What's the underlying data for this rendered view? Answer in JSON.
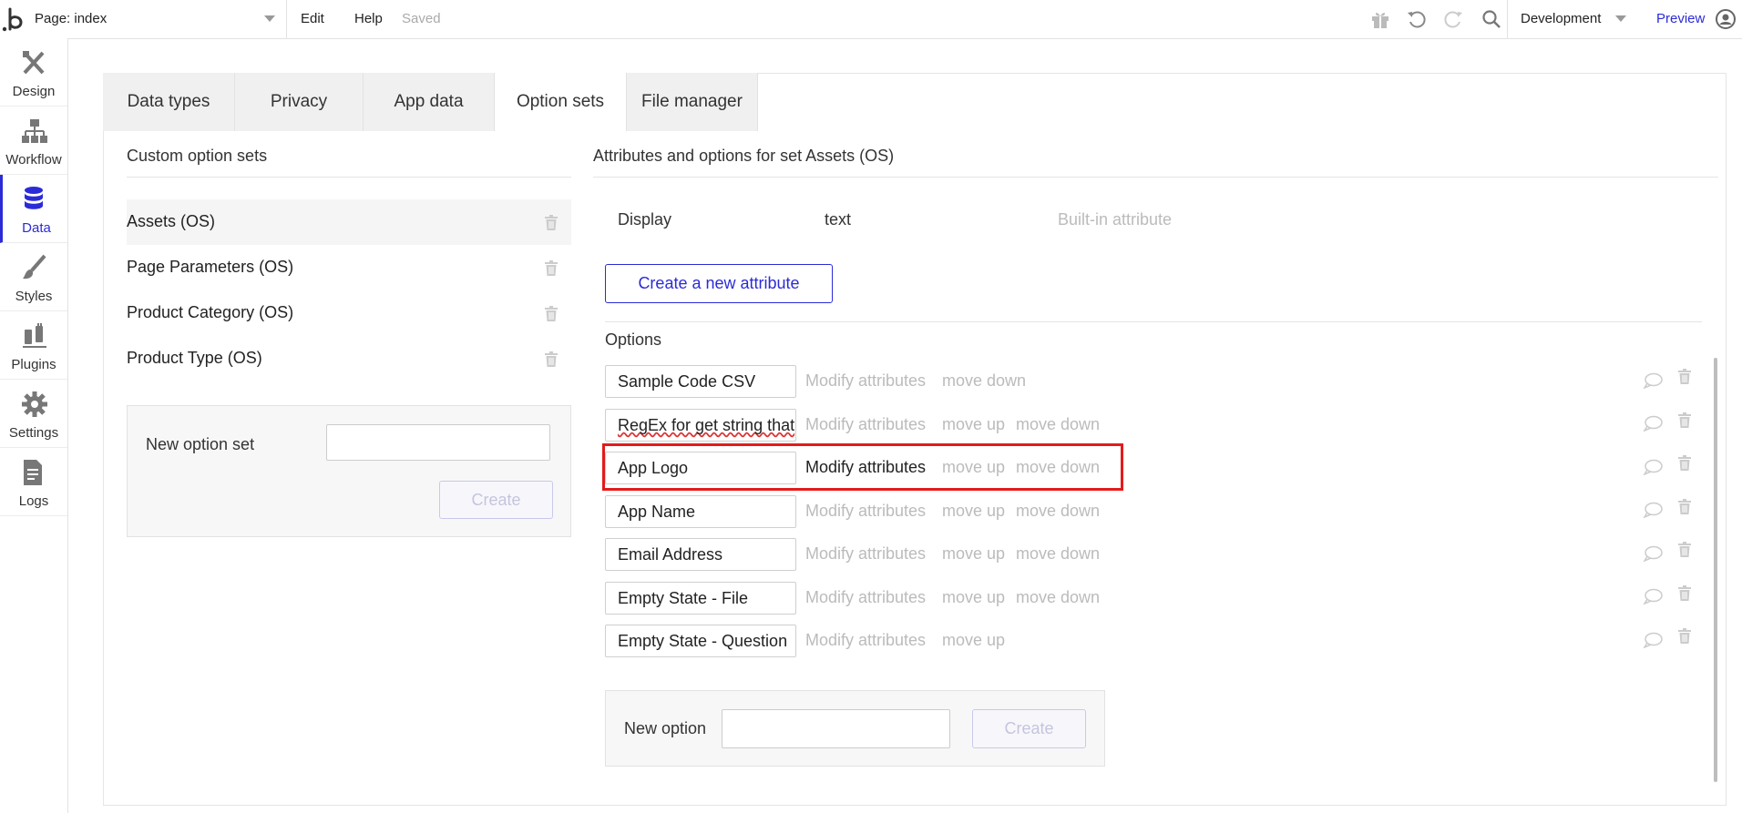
{
  "topbar": {
    "page_label": "Page: index",
    "menu": {
      "edit": "Edit",
      "help": "Help",
      "saved": "Saved"
    },
    "environment": "Development",
    "preview": "Preview",
    "icons": [
      "gift-icon",
      "undo-icon",
      "redo-icon",
      "search-icon",
      "user-icon"
    ]
  },
  "sidebar": {
    "items": [
      {
        "label": "Design",
        "icon": "design-icon"
      },
      {
        "label": "Workflow",
        "icon": "workflow-icon"
      },
      {
        "label": "Data",
        "icon": "database-icon",
        "active": true
      },
      {
        "label": "Styles",
        "icon": "brush-icon"
      },
      {
        "label": "Plugins",
        "icon": "plug-icon"
      },
      {
        "label": "Settings",
        "icon": "gear-icon"
      },
      {
        "label": "Logs",
        "icon": "document-icon"
      }
    ]
  },
  "tabs": [
    {
      "label": "Data types"
    },
    {
      "label": "Privacy"
    },
    {
      "label": "App data"
    },
    {
      "label": "Option sets",
      "active": true
    },
    {
      "label": "File manager"
    }
  ],
  "option_sets": {
    "title": "Custom option sets",
    "items": [
      {
        "name": "Assets (OS)",
        "selected": true
      },
      {
        "name": "Page Parameters (OS)"
      },
      {
        "name": "Product Category (OS)"
      },
      {
        "name": "Product Type (OS)"
      }
    ],
    "new_set": {
      "label": "New option set",
      "value": "",
      "create_label": "Create"
    }
  },
  "attributes": {
    "title": "Attributes and options for set Assets (OS)",
    "builtin": {
      "name": "Display",
      "type": "text",
      "note": "Built-in attribute"
    },
    "create_button": "Create a new attribute"
  },
  "options": {
    "title": "Options",
    "modify_label": "Modify attributes",
    "move_up_label": "move up",
    "move_down_label": "move down",
    "items": [
      {
        "value": "Sample Code CSV"
      },
      {
        "value": "RegEx for get string that"
      },
      {
        "value": "App Logo",
        "highlighted": true
      },
      {
        "value": "App Name"
      },
      {
        "value": "Email Address"
      },
      {
        "value": "Empty State - File"
      },
      {
        "value": "Empty State - Question"
      }
    ],
    "new_option": {
      "label": "New option",
      "value": "",
      "create_label": "Create"
    }
  },
  "colors": {
    "accent": "#2b2bd8",
    "highlight_border": "#e31b1b",
    "muted_text": "#bbbbbb"
  }
}
